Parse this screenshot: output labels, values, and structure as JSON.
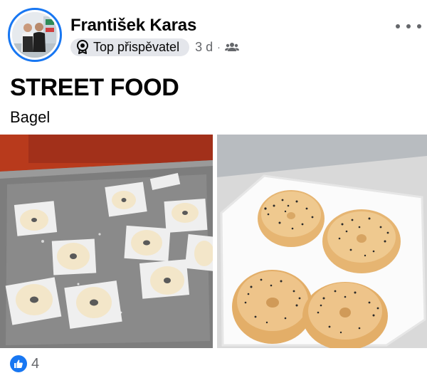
{
  "post": {
    "author": {
      "name": "František Karas",
      "badge": "Top přispěvatel",
      "time": "3 d",
      "audience_icon": "group-icon"
    },
    "title": "STREET FOOD",
    "subtitle": "Bagel",
    "photos": [
      {
        "subject": "bagel-dough-on-baking-tray"
      },
      {
        "subject": "baked-poppy-seed-bagels-on-plate"
      }
    ],
    "reactions": {
      "type": "like",
      "count": "4"
    },
    "colors": {
      "accent": "#1877f2",
      "badge_bg": "#e4e6eb",
      "secondary_text": "#65676b"
    }
  }
}
